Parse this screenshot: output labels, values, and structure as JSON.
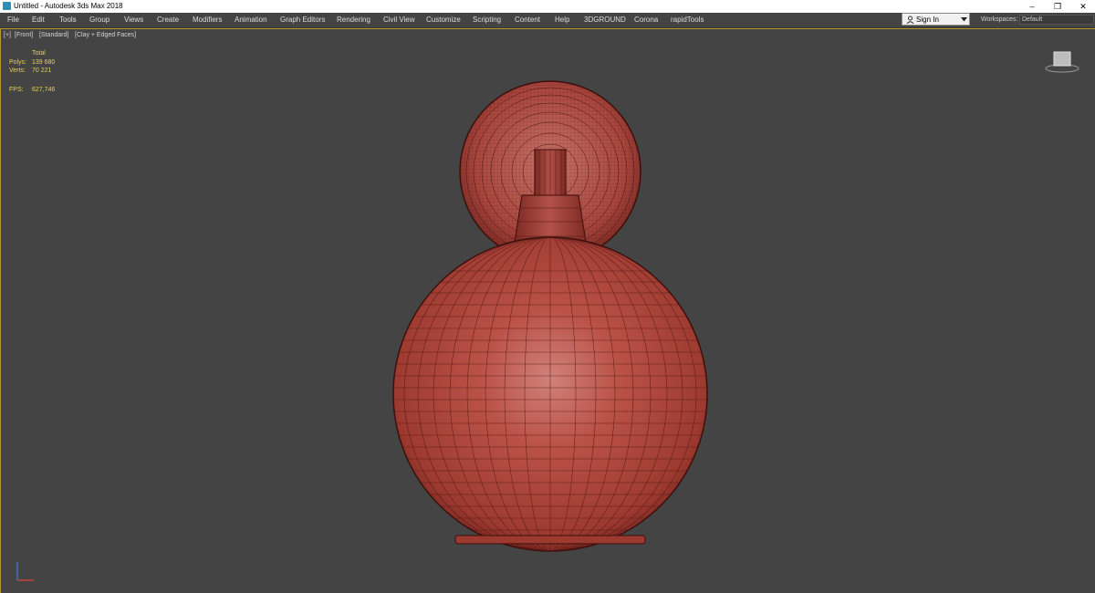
{
  "titlebar": {
    "title": "Untitled - Autodesk 3ds Max 2018",
    "minimize": "–",
    "restore": "❐",
    "close": "✕"
  },
  "menu": [
    "File",
    "Edit",
    "Tools",
    "Group",
    "Views",
    "Create",
    "Modifiers",
    "Animation",
    "Graph Editors",
    "Rendering",
    "Civil View",
    "Customize",
    "Scripting",
    "Content",
    "Help",
    "3DGROUND",
    "Corona",
    "rapidTools"
  ],
  "signin": {
    "label": "Sign In"
  },
  "workspaces": {
    "label": "Workspaces:",
    "value": "Default"
  },
  "viewport": {
    "plus": "[+]",
    "view": "[Front]",
    "style": "[Standard]",
    "shading": "[Clay + Edged Faces]"
  },
  "stats": {
    "header": "Total",
    "polys_label": "Polys:",
    "polys_value": "139 680",
    "verts_label": "Verts:",
    "verts_value": "70 221",
    "fps_label": "FPS:",
    "fps_value": "627,746"
  },
  "colors": {
    "mesh": "#b8433a",
    "wire": "#3c0f0c",
    "viewport_bg": "#444444",
    "stats": "#e6d34a",
    "active_border": "#b59a2a"
  },
  "icons": {
    "app": "3dsmax-icon",
    "user": "user-icon",
    "dropdown": "chevron-down-icon",
    "viewcube": "viewcube-icon",
    "axis": "axis-tripod-icon"
  }
}
